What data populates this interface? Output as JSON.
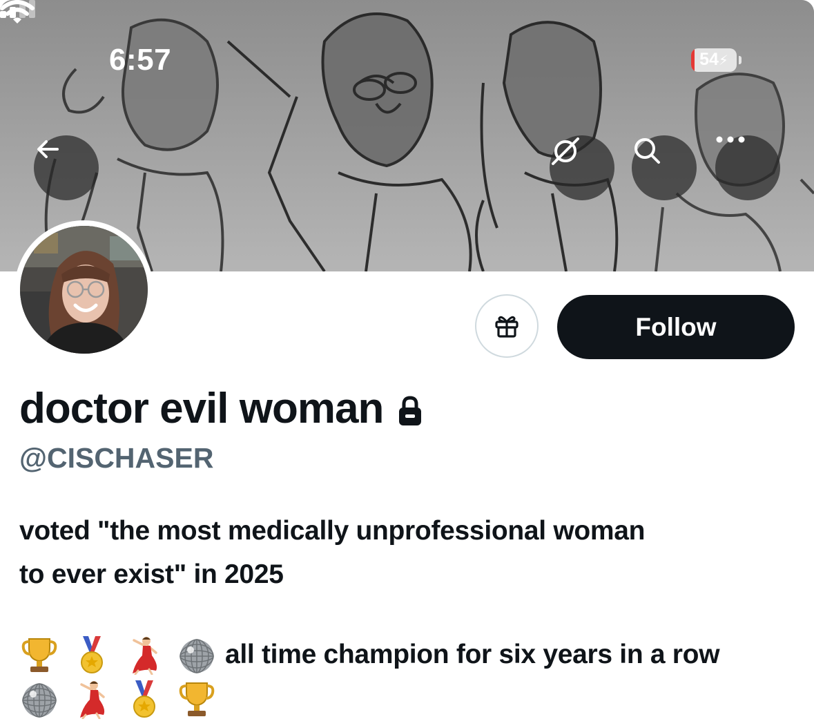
{
  "status_bar": {
    "time": "6:57",
    "battery": "54"
  },
  "banner": {
    "back_icon": "arrow-left-icon",
    "grok_icon": "grok-icon",
    "search_icon": "search-icon",
    "more_icon": "more-horizontal-icon"
  },
  "actions": {
    "gift_icon": "gift-icon",
    "follow_label": "Follow"
  },
  "profile": {
    "display_name": "doctor evil woman",
    "protected_icon": "lock-icon",
    "handle": "@CISCHASER",
    "bio_line_1": "voted \"the most medically unprofessional woman",
    "bio_line_2": "to ever exist\" in 2025",
    "champion_text": "all time champion for six years in a row",
    "emoji_row_1": [
      "trophy",
      "medal",
      "dancer",
      "disco-ball"
    ],
    "emoji_row_2": [
      "disco-ball",
      "dancer",
      "medal",
      "trophy"
    ]
  },
  "colors": {
    "text": "#0f1419",
    "secondary_text": "#536471",
    "follow_bg": "#0f1419",
    "border": "#cfd9de"
  }
}
